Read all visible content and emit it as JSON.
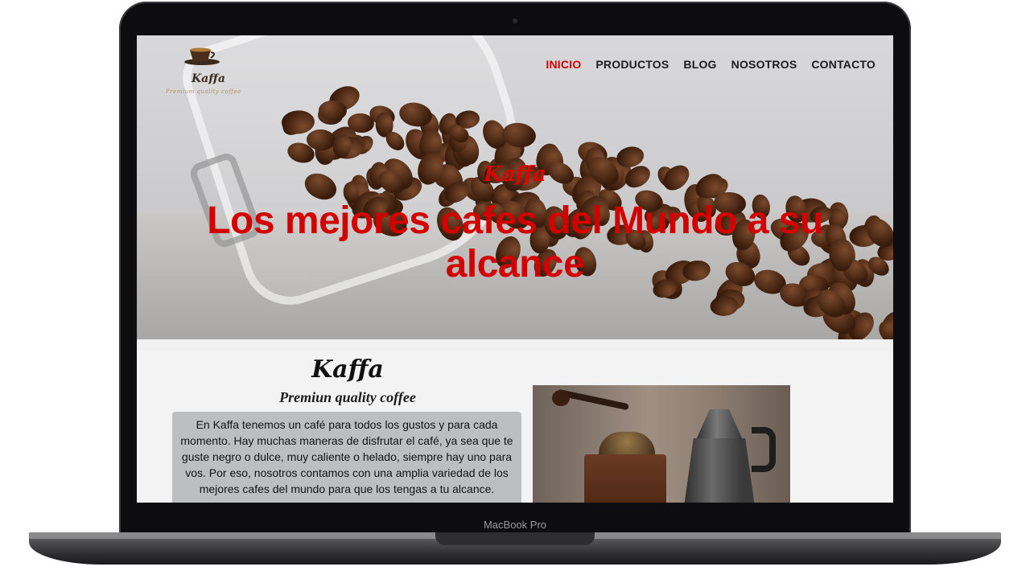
{
  "device": {
    "model_label": "MacBook Pro"
  },
  "logo": {
    "name": "Kaffa",
    "tagline": "Premium quality coffee"
  },
  "nav": {
    "items": [
      {
        "label": "INICIO",
        "active": true
      },
      {
        "label": "PRODUCTOS",
        "active": false
      },
      {
        "label": "BLOG",
        "active": false
      },
      {
        "label": "NOSOTROS",
        "active": false
      },
      {
        "label": "CONTACTO",
        "active": false
      }
    ]
  },
  "hero": {
    "brand": "Kaffa",
    "title": "Los mejores cafes del Mundo a su alcance"
  },
  "about": {
    "brand": "Kaffa",
    "tagline": "Premiun quality coffee",
    "body": "En Kaffa tenemos un café para todos los gustos y para cada momento. Hay muchas maneras de disfrutar el café, ya sea que te guste negro o dulce, muy caliente o helado, siempre hay uno para vos. Por eso, nosotros contamos con una amplia variedad de los mejores cafes del mundo para que los tengas a tu alcance."
  },
  "colors": {
    "accent": "#d40000",
    "text": "#1c1c1c"
  }
}
